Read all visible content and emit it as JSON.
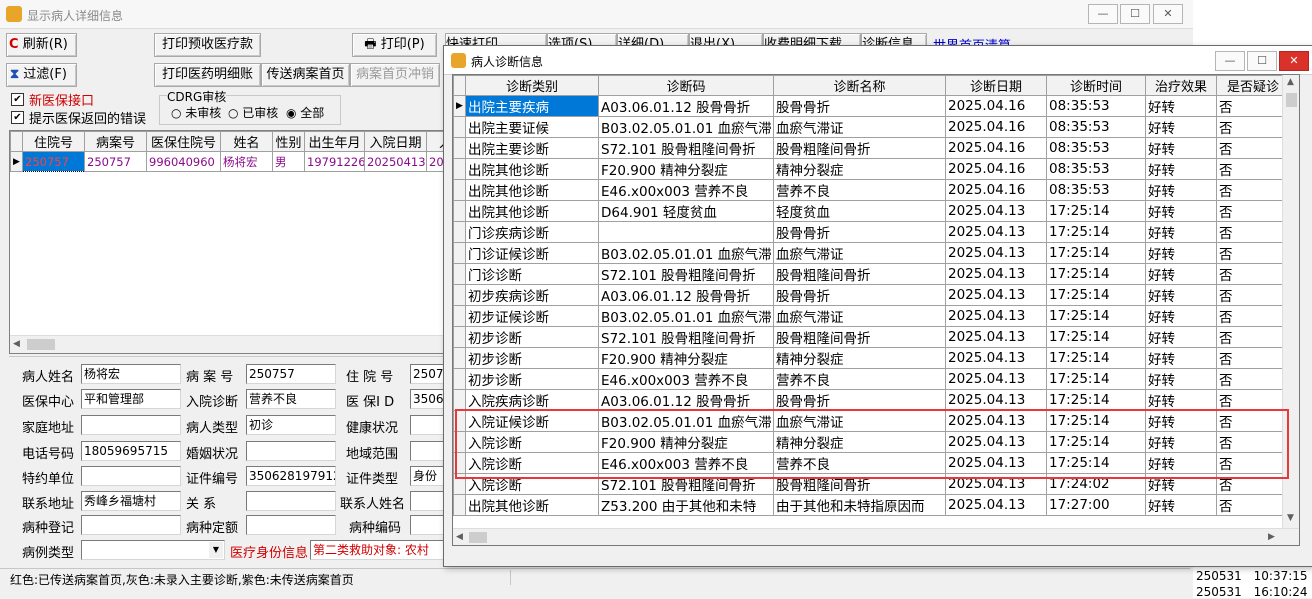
{
  "window": {
    "title": "显示病人详细信息",
    "min": "—",
    "max": "☐",
    "close": "✕"
  },
  "toolbar": {
    "refresh": "刷新(R)",
    "print_receipt": "打印预收医疗款",
    "print": "打印(P)",
    "quick_print": "快速打印",
    "select": "选项(S)",
    "detail": "详细(D)",
    "exit": "退出(X)",
    "fee_detail": "收费明细下载",
    "diag_info": "诊断信息",
    "link_case": "世界首页清算",
    "filter": "过滤(F)",
    "print_drug_detail": "打印医药明细账",
    "send_case": "传送病案首页",
    "case_reverse": "病案首页冲销"
  },
  "options": {
    "new_insurance": "新医保接口",
    "show_errors": "提示医保返回的错误",
    "cdrg_label": "CDRG审核",
    "radio_unreviewed": "未审核",
    "radio_reviewed": "已审核",
    "radio_all": "全部"
  },
  "patient_list": {
    "columns": [
      "住院号",
      "病案号",
      "医保住院号",
      "姓名",
      "性别",
      "出生年月",
      "入院日期",
      "入"
    ],
    "rows": [
      [
        "250757",
        "250757",
        "996040960",
        "杨将宏",
        "男",
        "19791226",
        "20250413",
        "20"
      ]
    ]
  },
  "form": {
    "name_label": "病人姓名",
    "name": "杨将宏",
    "case_label": "病 案 号",
    "case": "250757",
    "inpatient_label": "住 院 号",
    "inpatient": "2507",
    "center_label": "医保中心",
    "center": "平和管理部",
    "admit_diag_label": "入院诊断",
    "admit_diag": "营养不良",
    "insure_id_label": "医 保I D",
    "insure_id": "3506",
    "address_label": "家庭地址",
    "address": "",
    "ptype_label": "病人类型",
    "ptype": "初诊",
    "health_label": "健康状况",
    "health": "",
    "phone_label": "电话号码",
    "phone": "18059695715",
    "marital_label": "婚姻状况",
    "marital": "",
    "region_label": "地域范围",
    "region": "",
    "contract_label": "特约单位",
    "contract": "",
    "cert_no_label": "证件编号",
    "cert_no": "350628197912",
    "cert_type_label": "证件类型",
    "cert_type": "身份",
    "contact_addr_label": "联系地址",
    "contact_addr": "秀峰乡福塘村",
    "relation_label": "关    系",
    "relation": "",
    "contact_name_label": "联系人姓名",
    "contact_name": "",
    "disease_reg_label": "病种登记",
    "disease_reg": "",
    "disease_quota_label": "病种定额",
    "disease_quota": "",
    "disease_code_label": "病种编码",
    "disease_code": "",
    "case_type_label": "病例类型",
    "case_type": "",
    "identity_label": "医疗身份信息",
    "identity": "第二类救助对象: 农村",
    "dropdown_arrow": "▼"
  },
  "status_bar": "红色:已传送病案首页,灰色:未录入主要诊断,紫色:未传送病案首页",
  "right_panel": {
    "rows": [
      [
        "250531",
        "10:37:15"
      ],
      [
        "250531",
        "16:10:24"
      ]
    ]
  },
  "dialog": {
    "title": "病人诊断信息",
    "min": "—",
    "max": "☐",
    "close": "✕",
    "columns": [
      "诊断类别",
      "诊断码",
      "诊断名称",
      "诊断日期",
      "诊断时间",
      "治疗效果",
      "是否疑诊"
    ],
    "rows": [
      [
        "出院主要疾病",
        "A03.06.01.12 股骨骨折",
        "股骨骨折",
        "2025.04.16",
        "08:35:53",
        "好转",
        "否"
      ],
      [
        "出院主要证候",
        "B03.02.05.01.01 血瘀气滞",
        "血瘀气滞证",
        "2025.04.16",
        "08:35:53",
        "好转",
        "否"
      ],
      [
        "出院主要诊断",
        "S72.101 股骨粗隆间骨折",
        "股骨粗隆间骨折",
        "2025.04.16",
        "08:35:53",
        "好转",
        "否"
      ],
      [
        "出院其他诊断",
        "F20.900 精神分裂症",
        "精神分裂症",
        "2025.04.16",
        "08:35:53",
        "好转",
        "否"
      ],
      [
        "出院其他诊断",
        "E46.x00x003 营养不良",
        "营养不良",
        "2025.04.16",
        "08:35:53",
        "好转",
        "否"
      ],
      [
        "出院其他诊断",
        "D64.901 轻度贫血",
        "轻度贫血",
        "2025.04.13",
        "17:25:14",
        "好转",
        "否"
      ],
      [
        "门诊疾病诊断",
        "",
        "股骨骨折",
        "2025.04.13",
        "17:25:14",
        "好转",
        "否"
      ],
      [
        "门诊证候诊断",
        "B03.02.05.01.01 血瘀气滞",
        "血瘀气滞证",
        "2025.04.13",
        "17:25:14",
        "好转",
        "否"
      ],
      [
        "门诊诊断",
        "S72.101 股骨粗隆间骨折",
        "股骨粗隆间骨折",
        "2025.04.13",
        "17:25:14",
        "好转",
        "否"
      ],
      [
        "初步疾病诊断",
        "A03.06.01.12 股骨骨折",
        "股骨骨折",
        "2025.04.13",
        "17:25:14",
        "好转",
        "否"
      ],
      [
        "初步证候诊断",
        "B03.02.05.01.01 血瘀气滞",
        "血瘀气滞证",
        "2025.04.13",
        "17:25:14",
        "好转",
        "否"
      ],
      [
        "初步诊断",
        "S72.101 股骨粗隆间骨折",
        "股骨粗隆间骨折",
        "2025.04.13",
        "17:25:14",
        "好转",
        "否"
      ],
      [
        "初步诊断",
        "F20.900 精神分裂症",
        "精神分裂症",
        "2025.04.13",
        "17:25:14",
        "好转",
        "否"
      ],
      [
        "初步诊断",
        "E46.x00x003 营养不良",
        "营养不良",
        "2025.04.13",
        "17:25:14",
        "好转",
        "否"
      ],
      [
        "入院疾病诊断",
        "A03.06.01.12 股骨骨折",
        "股骨骨折",
        "2025.04.13",
        "17:25:14",
        "好转",
        "否"
      ],
      [
        "入院证候诊断",
        "B03.02.05.01.01 血瘀气滞",
        "血瘀气滞证",
        "2025.04.13",
        "17:25:14",
        "好转",
        "否"
      ],
      [
        "入院诊断",
        "F20.900 精神分裂症",
        "精神分裂症",
        "2025.04.13",
        "17:25:14",
        "好转",
        "否"
      ],
      [
        "入院诊断",
        "E46.x00x003 营养不良",
        "营养不良",
        "2025.04.13",
        "17:25:14",
        "好转",
        "否"
      ],
      [
        "入院诊断",
        "S72.101 股骨粗隆间骨折",
        "股骨粗隆间骨折",
        "2025.04.13",
        "17:24:02",
        "好转",
        "否"
      ],
      [
        "出院其他诊断",
        "Z53.200 由于其他和未特",
        "由于其他和未特指原因而",
        "2025.04.13",
        "17:27:00",
        "好转",
        "否"
      ]
    ]
  },
  "colors": {
    "selection": "#0078d7",
    "purple_text": "#8b0a8b",
    "red_highlight": "#e8393a",
    "link_blue": "#0000cc"
  }
}
